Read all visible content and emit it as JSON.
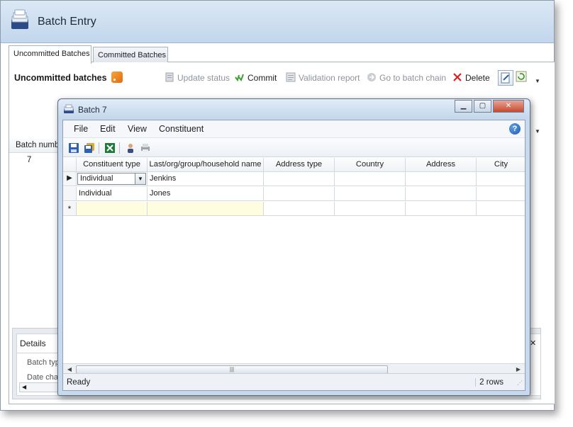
{
  "outer": {
    "title": "Batch Entry",
    "tabs": [
      {
        "label": "Uncommitted Batches",
        "active": true
      },
      {
        "label": "Committed Batches",
        "active": false
      }
    ],
    "panel_title": "Uncommitted batches",
    "toolbar": {
      "update_status": "Update status",
      "commit": "Commit",
      "validation_report": "Validation report",
      "go_to_batch_chain": "Go to batch chain",
      "delete": "Delete"
    },
    "grid": {
      "column": "Batch number",
      "value": "7"
    },
    "details": {
      "title": "Details",
      "label1": "Batch type",
      "label2": "Date changed"
    }
  },
  "batch_window": {
    "title": "Batch 7",
    "menu": [
      "File",
      "Edit",
      "View",
      "Constituent"
    ],
    "columns": [
      "Constituent type",
      "Last/org/group/household name",
      "Address type",
      "Country",
      "Address",
      "City"
    ],
    "rows": [
      {
        "constituent_type": "Individual",
        "name": "Jenkins",
        "address_type": "",
        "country": "",
        "address": "",
        "city": ""
      },
      {
        "constituent_type": "Individual",
        "name": "Jones",
        "address_type": "",
        "country": "",
        "address": "",
        "city": ""
      }
    ],
    "new_row_marker": "*",
    "status": {
      "left": "Ready",
      "right": "2 rows"
    }
  },
  "icons": {
    "app": "batch-stack-icon",
    "rss": "rss-feed-icon",
    "help": "help-icon",
    "save": "save-disk-icon",
    "save_all": "save-all-icon",
    "excel": "excel-export-icon",
    "constituent": "constituent-person-icon",
    "print": "printer-icon"
  },
  "colors": {
    "title_gradient_top": "#e1ecf8",
    "new_row_yellow": "#fefde0",
    "delete_red": "#d42020",
    "commit_green": "#3aa234"
  }
}
